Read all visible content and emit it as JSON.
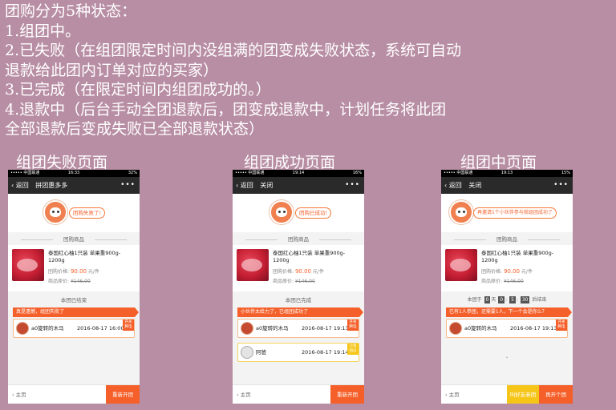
{
  "intro": {
    "lines": [
      "团购分为5种状态：",
      "1.组团中。",
      "2.已失败（在组团限定时间内没组满的团变成失败状态，系统可自动",
      "退款给此团内订单对应的买家）",
      "3.已完成（在限定时间内组团成功的。）",
      "4.退款中（后台手动全团退款后，团变成退款中，计划任务将此团",
      "全部退款后变成失败已全部退款状态）"
    ]
  },
  "captions": {
    "failed": "组团失败页面",
    "success": "组团成功页面",
    "inprogress": "组团中页面"
  },
  "product": {
    "section_title": "团购商品",
    "name": "泰国红心柚1只装 单果重900g-1200g",
    "group_price_label": "团购价格:",
    "group_price": "90.00",
    "group_price_unit": "元/件",
    "orig_price_label": "商品原价:",
    "orig_price": "¥146.00"
  },
  "phones": {
    "failed": {
      "status": {
        "carrier": "••••• 中国联通 ",
        "time": "16:33",
        "battery": "32%"
      },
      "nav": {
        "back": "返回",
        "title": "拼团惠多多",
        "more": "•••"
      },
      "banner": "团购失败了!",
      "section2": "本团已结束",
      "tip": "真是遗憾，组团失败了",
      "member": {
        "name": "a0旋转的木马",
        "time": "2016-08-17 16:00",
        "tag": "开关 腾电"
      },
      "footer": {
        "home": "主页",
        "btn": "重新开团"
      }
    },
    "success": {
      "status": {
        "carrier": "••••• 中国联通 ",
        "time": "19:14",
        "battery": "16%"
      },
      "nav": {
        "back": "返回",
        "title": "关闭",
        "more": "•••"
      },
      "banner": "团购已成功!",
      "section2": "本团已完成",
      "tip": "小伙伴太给力了，已组团成功了",
      "member": {
        "name": "a0旋转的木马",
        "time": "2016-08-17 19:13",
        "tag": "开关 腾电"
      },
      "member2": {
        "name": "阿爸",
        "time": "2016-08-17 19:14",
        "tag": "沙发 团员"
      },
      "footer": {
        "home": "主页",
        "btn": "重新开团"
      }
    },
    "inprogress": {
      "status": {
        "carrier": "••••• 中国联通 ",
        "time": "19:13",
        "battery": "15%"
      },
      "nav": {
        "back": "返回",
        "title": "关闭",
        "more": "•••"
      },
      "banner": "再邀请1个小伙伴参与就组团成功了",
      "countdown": {
        "pre": "本团于",
        "d": "0",
        "du": "天",
        "h": "0",
        "m": "5",
        "s": "30",
        "post": "后结束"
      },
      "tip": "已有1人参团，还需要1人，下一个会是你么？",
      "member": {
        "name": "a0旋转的木马",
        "time": "2016-08-17 19:13",
        "tag": "开关 腾电"
      },
      "footer": {
        "home": "主页",
        "btn1": "叫好友参团",
        "btn2": "再开个团"
      }
    }
  },
  "colors": {
    "accent": "#f5602a",
    "yellow": "#f5c518",
    "background": "#b88ea4"
  }
}
